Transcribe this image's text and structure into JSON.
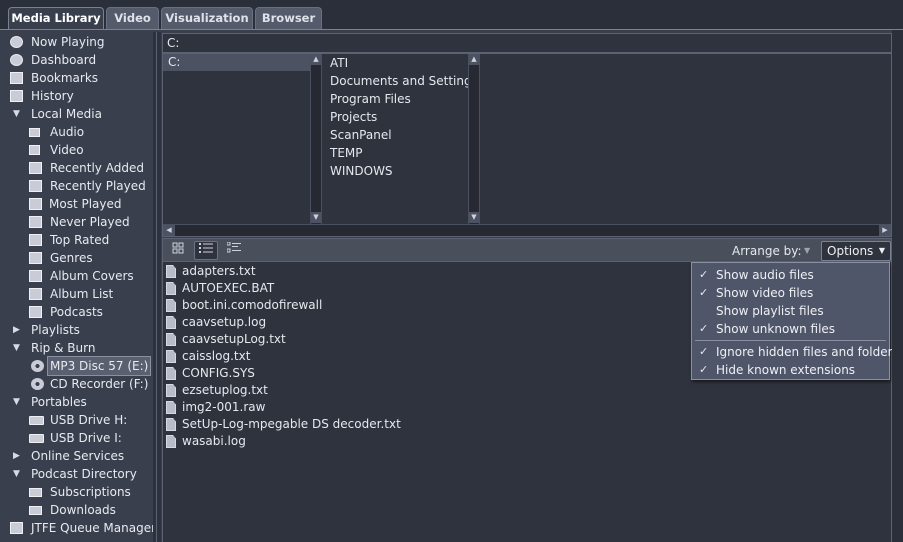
{
  "tabs": [
    {
      "label": "Media Library",
      "active": true
    },
    {
      "label": "Video",
      "active": false
    },
    {
      "label": "Visualization",
      "active": false
    },
    {
      "label": "Browser",
      "active": false
    }
  ],
  "sidebar": {
    "items": [
      {
        "label": "Now Playing",
        "icon": "play-icon"
      },
      {
        "label": "Dashboard",
        "icon": "dashboard-icon"
      },
      {
        "label": "Bookmarks",
        "icon": "bookmark-icon"
      },
      {
        "label": "History",
        "icon": "history-icon"
      },
      {
        "label": "Local Media",
        "icon": "expand-arrow-icon"
      },
      {
        "label": "Audio",
        "icon": "speaker-icon"
      },
      {
        "label": "Video",
        "icon": "film-icon"
      },
      {
        "label": "Recently Added",
        "icon": "smart-view-icon"
      },
      {
        "label": "Recently Played",
        "icon": "smart-view-icon"
      },
      {
        "label": "Most Played",
        "icon": "smart-view-icon"
      },
      {
        "label": "Never Played",
        "icon": "smart-view-icon"
      },
      {
        "label": "Top Rated",
        "icon": "smart-view-icon"
      },
      {
        "label": "Genres",
        "icon": "folder-icon"
      },
      {
        "label": "Album Covers",
        "icon": "folder-icon"
      },
      {
        "label": "Album List",
        "icon": "folder-icon"
      },
      {
        "label": "Podcasts",
        "icon": "podcast-icon"
      },
      {
        "label": "Playlists",
        "icon": "collapse-arrow-icon"
      },
      {
        "label": "Rip & Burn",
        "icon": "expand-arrow-icon"
      },
      {
        "label": "MP3 Disc 57 (E:)",
        "icon": "disc-icon"
      },
      {
        "label": "CD Recorder (F:)",
        "icon": "disc-icon"
      },
      {
        "label": "Portables",
        "icon": "expand-arrow-icon"
      },
      {
        "label": "USB Drive H:",
        "icon": "usb-drive-icon"
      },
      {
        "label": "USB Drive I:",
        "icon": "usb-drive-icon"
      },
      {
        "label": "Online Services",
        "icon": "collapse-arrow-icon"
      },
      {
        "label": "Podcast Directory",
        "icon": "expand-arrow-icon"
      },
      {
        "label": "Subscriptions",
        "icon": "folder-icon"
      },
      {
        "label": "Downloads",
        "icon": "download-icon"
      },
      {
        "label": "JTFE Queue Manager",
        "icon": "queue-icon"
      }
    ],
    "selected": "MP3 Disc 57 (E:)"
  },
  "path": "C:",
  "browser": {
    "drives": [
      "C:"
    ],
    "folders": [
      "ATI",
      "Documents and Settings",
      "Program Files",
      "Projects",
      "ScanPanel",
      "TEMP",
      "WINDOWS"
    ]
  },
  "toolbar": {
    "arrange_label": "Arrange by:",
    "options_label": "Options"
  },
  "files": [
    "adapters.txt",
    "AUTOEXEC.BAT",
    "boot.ini.comodofirewall",
    "caavsetup.log",
    "caavsetupLog.txt",
    "caisslog.txt",
    "CONFIG.SYS",
    "ezsetuplog.txt",
    "img2-001.raw",
    "SetUp-Log-mpegable DS decoder.txt",
    "wasabi.log"
  ],
  "options_menu": {
    "group1": [
      {
        "label": "Show audio files",
        "checked": true
      },
      {
        "label": "Show video files",
        "checked": true
      },
      {
        "label": "Show playlist files",
        "checked": false
      },
      {
        "label": "Show unknown files",
        "checked": true
      }
    ],
    "group2": [
      {
        "label": "Ignore hidden files and folders",
        "checked": true
      },
      {
        "label": "Hide known extensions",
        "checked": true
      }
    ]
  },
  "glyphs": {
    "check": "✓",
    "up": "▲",
    "down": "▼",
    "left": "◀",
    "right": "▶",
    "expanded": "▼",
    "collapsed": "▶",
    "dropdown": "▼"
  }
}
